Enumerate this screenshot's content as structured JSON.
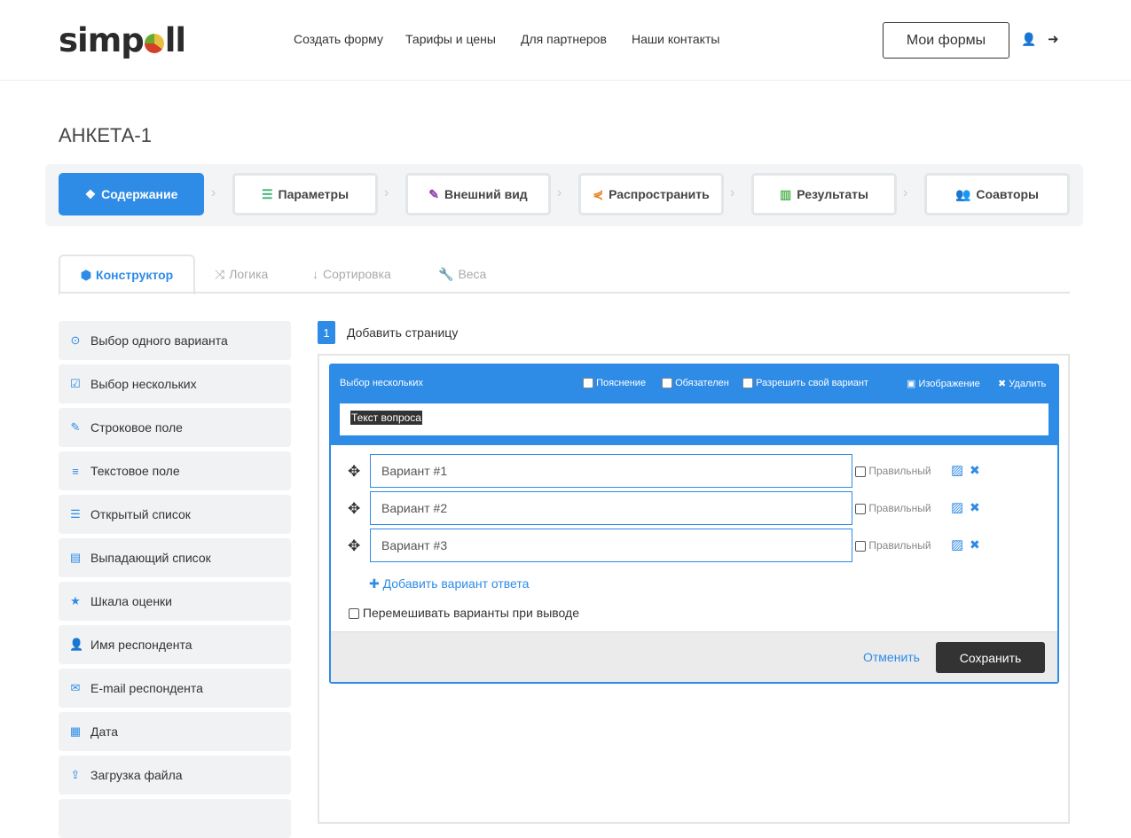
{
  "header": {
    "logo": "simpoll",
    "nav": [
      "Создать форму",
      "Тарифы и цены",
      "Для партнеров",
      "Наши контакты"
    ],
    "my_forms": "Мои формы"
  },
  "title": "АНКЕТА-1",
  "steps": [
    {
      "label": "Содержание",
      "icon": "cubes-icon",
      "color": "#ffffff"
    },
    {
      "label": "Параметры",
      "icon": "sliders-icon",
      "color": "#3cb371"
    },
    {
      "label": "Внешний вид",
      "icon": "brush-icon",
      "color": "#8e44ad"
    },
    {
      "label": "Распространить",
      "icon": "share-icon",
      "color": "#e67e22"
    },
    {
      "label": "Результаты",
      "icon": "bar-chart-icon",
      "color": "#5cb85c"
    },
    {
      "label": "Соавторы",
      "icon": "users-icon",
      "color": "#d05fa8"
    }
  ],
  "tabs": [
    "Конструктор",
    "Логика",
    "Сортировка",
    "Веса"
  ],
  "sidebar": [
    {
      "label": "Выбор одного варианта",
      "icon": "⊙"
    },
    {
      "label": "Выбор нескольких",
      "icon": "☑"
    },
    {
      "label": "Строковое поле",
      "icon": "✎"
    },
    {
      "label": "Текстовое поле",
      "icon": "≡"
    },
    {
      "label": "Открытый список",
      "icon": "☰"
    },
    {
      "label": "Выпадающий список",
      "icon": "▤"
    },
    {
      "label": "Шкала оценки",
      "icon": "★"
    },
    {
      "label": "Имя респондента",
      "icon": "👤"
    },
    {
      "label": "E-mail респондента",
      "icon": "✉"
    },
    {
      "label": "Дата",
      "icon": "▦"
    },
    {
      "label": "Загрузка файла",
      "icon": "⇪"
    }
  ],
  "page": {
    "number": "1",
    "add_page": "Добавить страницу"
  },
  "question": {
    "type": "Выбор нескольких",
    "options_labels": [
      "Пояснение",
      "Обязателен",
      "Разрешить свой вариант"
    ],
    "image": "Изображение",
    "delete": "Удалить",
    "text": "Текст вопроса",
    "answers": [
      "Вариант #1",
      "Вариант #2",
      "Вариант #3"
    ],
    "correct_label": "Правильный",
    "add_answer": "Добавить вариант ответа",
    "shuffle": "Перемешивать варианты при выводе",
    "cancel": "Отменить",
    "save": "Сохранить"
  }
}
